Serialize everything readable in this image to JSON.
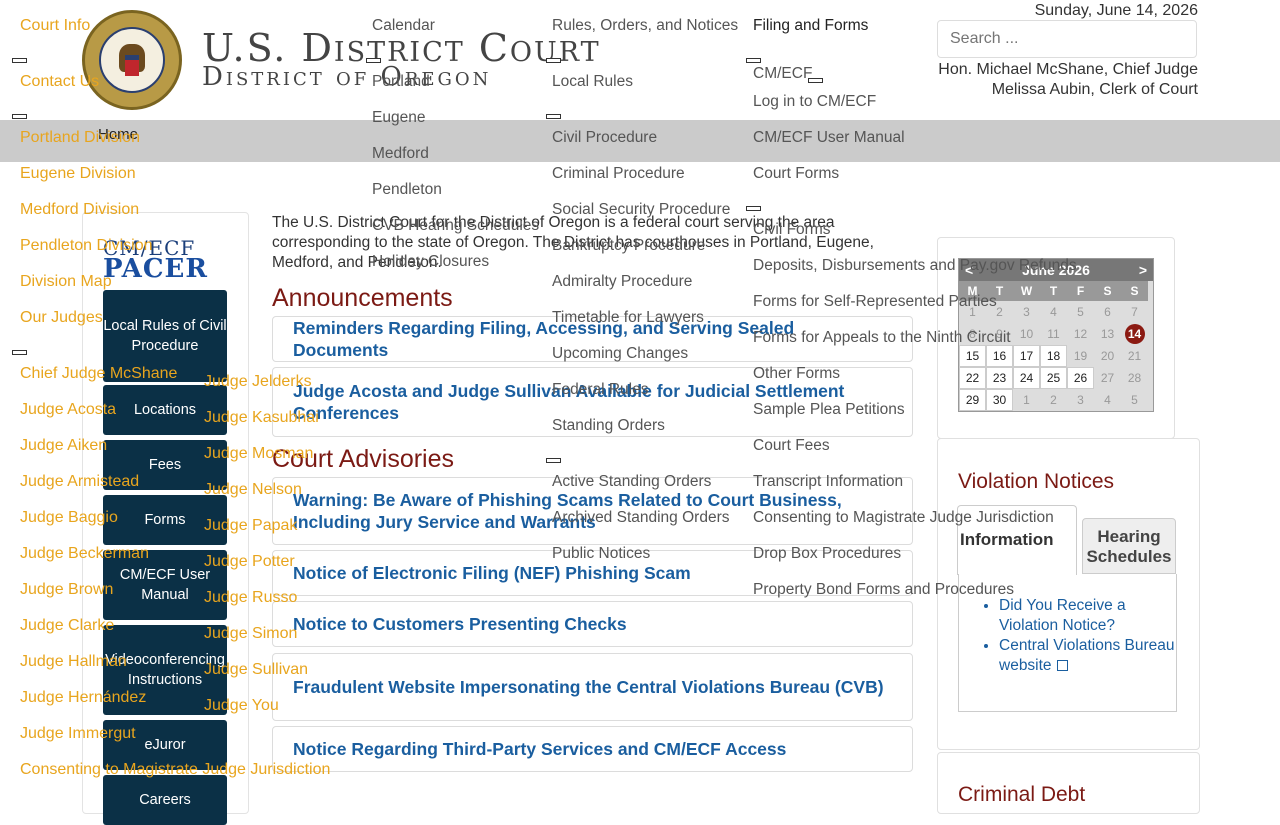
{
  "header": {
    "date": "Sunday, June 14, 2026",
    "search_placeholder": "Search ...",
    "chief_judge": "Hon. Michael McShane, Chief Judge",
    "clerk": "Melissa Aubin, Clerk of Court",
    "brand_line1": "U.S. District Court",
    "brand_line2": "District of Oregon",
    "seal_text": "UNITED STATES DISTRICT COURT · DISTRICT OF OREGON"
  },
  "nav": {
    "home": "Home"
  },
  "menu_col1": [
    "Court Info",
    "Contact Us",
    "Portland Division",
    "Eugene Division",
    "Medford Division",
    "Pendleton Division",
    "Division Map",
    "Our Judges",
    "Chief Judge McShane",
    "Judge Acosta",
    "Judge Aiken",
    "Judge Armistead",
    "Judge Baggio",
    "Judge Beckerman",
    "Judge Brown",
    "Judge Clarke",
    "Judge Hallman",
    "Judge Hernández",
    "Judge Immergut",
    "Consenting to Magistrate Judge Jurisdiction"
  ],
  "menu_col2": [
    "Judge Jelderks",
    "Judge Kasubhai",
    "Judge Mosman",
    "Judge Nelson",
    "Judge Papak",
    "Judge Potter",
    "Judge Russo",
    "Judge Simon",
    "Judge Sullivan",
    "Judge You"
  ],
  "menu_col3": [
    "Calendar",
    "Portland",
    "Eugene",
    "Medford",
    "Pendleton",
    "CVB Hearing Schedules",
    "Holiday Closures"
  ],
  "menu_col4": [
    "Rules, Orders, and Notices",
    "Local Rules",
    "Civil Procedure",
    "Criminal Procedure",
    "Social Security Procedure",
    "Bankruptcy Procedure",
    "Admiralty Procedure",
    "Timetable for Lawyers",
    "Upcoming Changes",
    "Federal Rules",
    "Standing Orders",
    "Active Standing Orders",
    "Archived Standing Orders",
    "Public Notices"
  ],
  "menu_col5": [
    "Filing and Forms",
    "CM/ECF",
    "Log in to CM/ECF",
    "CM/ECF User Manual",
    "Court Forms",
    "Civil Forms",
    "Deposits, Disbursements and Pay.gov Refunds",
    "Forms for Self-Represented Parties",
    "Forms for Appeals to the Ninth Circuit",
    "Other Forms",
    "Sample Plea Petitions",
    "Court Fees",
    "Transcript Information",
    "Consenting to Magistrate Judge Jurisdiction",
    "Drop Box Procedures",
    "Property Bond Forms and Procedures"
  ],
  "sidebar": {
    "logo_top": "CM/ECF",
    "logo_bottom": "PACER",
    "buttons": [
      "Local Rules of Civil Procedure",
      "Locations",
      "Fees",
      "Forms",
      "CM/ECF User Manual",
      "Videoconferencing Instructions",
      "eJuror",
      "Careers"
    ]
  },
  "main": {
    "intro": "The U.S. District Court for the District of Oregon is a federal court serving the area corresponding to the state of Oregon. The District has courthouses in Portland, Eugene, Medford, and Pendleton.",
    "announcements_heading": "Announcements",
    "announcements": [
      "Reminders Regarding Filing, Accessing, and Serving Sealed Documents",
      "Judge Acosta and Judge Sullivan Available for Judicial Settlement Conferences"
    ],
    "advisories_heading": "Court Advisories",
    "advisories": [
      "Warning: Be Aware of Phishing Scams Related to Court Business, Including Jury Service and Warrants",
      "Notice of Electronic Filing (NEF) Phishing Scam",
      "Notice to Customers Presenting Checks",
      "Fraudulent Website Impersonating the Central Violations Bureau (CVB)",
      "Notice Regarding Third-Party Services and CM/ECF Access"
    ]
  },
  "calendar": {
    "month": "June 2026",
    "prev": "<",
    "next": ">",
    "dow": [
      "M",
      "T",
      "W",
      "T",
      "F",
      "S",
      "S"
    ],
    "weeks": [
      [
        "1",
        "2",
        "3",
        "4",
        "5",
        "6",
        "7"
      ],
      [
        "8",
        "9",
        "10",
        "11",
        "12",
        "13",
        "14"
      ],
      [
        "15",
        "16",
        "17",
        "18",
        "19",
        "20",
        "21"
      ],
      [
        "22",
        "23",
        "24",
        "25",
        "26",
        "27",
        "28"
      ],
      [
        "29",
        "30",
        "1",
        "2",
        "3",
        "4",
        "5"
      ]
    ],
    "today": "14"
  },
  "violations": {
    "heading": "Violation Notices",
    "tab_active": "Information",
    "tab_inactive": "Hearing Schedules",
    "links": [
      "Did You Receive a Violation Notice?",
      "Central Violations Bureau website"
    ]
  },
  "criminal_debt": {
    "heading": "Criminal Debt"
  }
}
